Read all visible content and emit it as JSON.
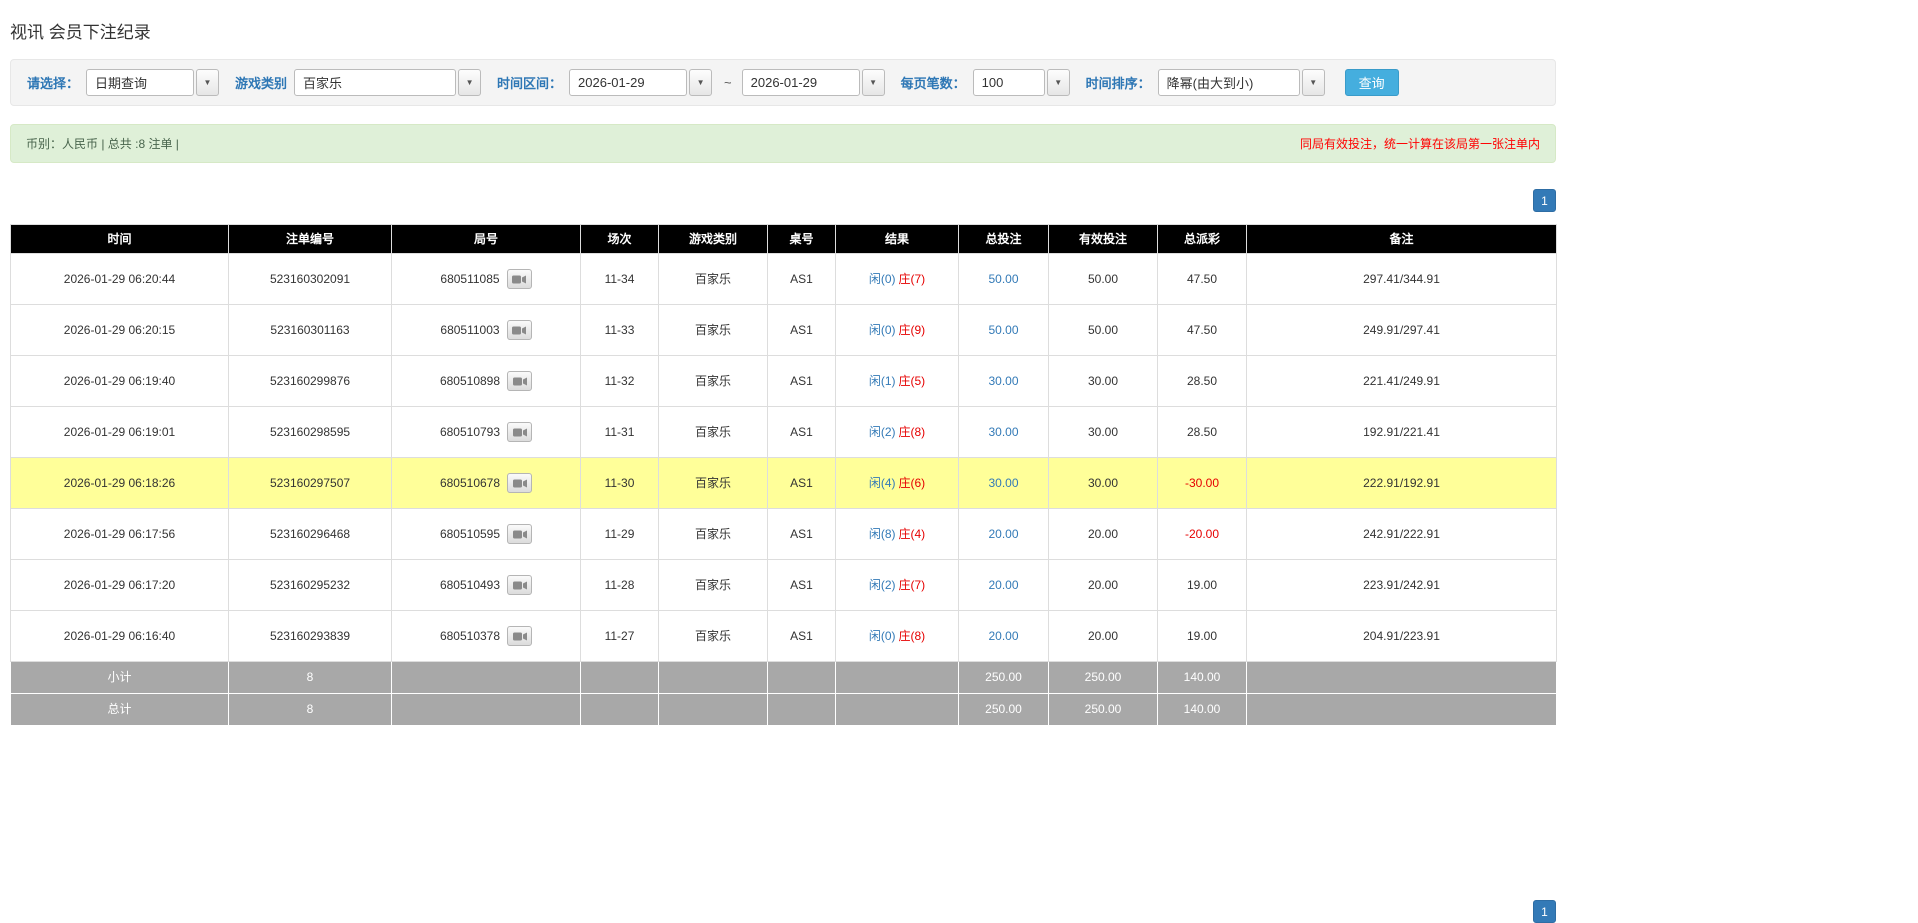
{
  "page": {
    "title": "视讯 会员下注纪录"
  },
  "filters": {
    "select": {
      "label": "请选择：",
      "value": "日期查询"
    },
    "game_type": {
      "label": "游戏类别",
      "value": "百家乐"
    },
    "time_range": {
      "label": "时间区间：",
      "from": "2026-01-29",
      "separator": "~",
      "to": "2026-01-29"
    },
    "page_size": {
      "label": "每页笔数：",
      "value": "100"
    },
    "sort": {
      "label": "时间排序：",
      "value": "降幂(由大到小)"
    },
    "search_button": "查询"
  },
  "summary": {
    "currency_info": "币别：人民币 | 总共 :8 注单 |",
    "notice": "同局有效投注，统一计算在该局第一张注单内"
  },
  "pagination": {
    "current_page": "1"
  },
  "icons": {
    "dropdown_caret": "▼",
    "video_replay": "video-replay-icon"
  },
  "colors": {
    "accent_blue": "#337ab7",
    "result_red": "#e60000",
    "highlight_yellow": "#ffff99",
    "header_black": "#000000",
    "footer_gray": "#a8a8a8",
    "search_button_blue": "#45aede",
    "summary_green_bg": "#dff0d8",
    "notice_red": "#ff0000"
  },
  "table": {
    "headers": [
      "时间",
      "注单编号",
      "局号",
      "场次",
      "游戏类别",
      "桌号",
      "结果",
      "总投注",
      "有效投注",
      "总派彩",
      "备注"
    ],
    "rows": [
      {
        "time": "2026-01-29 06:20:44",
        "bet_id": "523160302091",
        "round_id": "680511085",
        "session": "11-34",
        "game": "百家乐",
        "table_no": "AS1",
        "result_player": "闲(0)",
        "result_banker": "庄(7)",
        "total_bet": "50.00",
        "valid_bet": "50.00",
        "payout": "47.50",
        "remark": "297.41/344.91",
        "highlighted": false
      },
      {
        "time": "2026-01-29 06:20:15",
        "bet_id": "523160301163",
        "round_id": "680511003",
        "session": "11-33",
        "game": "百家乐",
        "table_no": "AS1",
        "result_player": "闲(0)",
        "result_banker": "庄(9)",
        "total_bet": "50.00",
        "valid_bet": "50.00",
        "payout": "47.50",
        "remark": "249.91/297.41",
        "highlighted": false
      },
      {
        "time": "2026-01-29 06:19:40",
        "bet_id": "523160299876",
        "round_id": "680510898",
        "session": "11-32",
        "game": "百家乐",
        "table_no": "AS1",
        "result_player": "闲(1)",
        "result_banker": "庄(5)",
        "total_bet": "30.00",
        "valid_bet": "30.00",
        "payout": "28.50",
        "remark": "221.41/249.91",
        "highlighted": false
      },
      {
        "time": "2026-01-29 06:19:01",
        "bet_id": "523160298595",
        "round_id": "680510793",
        "session": "11-31",
        "game": "百家乐",
        "table_no": "AS1",
        "result_player": "闲(2)",
        "result_banker": "庄(8)",
        "total_bet": "30.00",
        "valid_bet": "30.00",
        "payout": "28.50",
        "remark": "192.91/221.41",
        "highlighted": false
      },
      {
        "time": "2026-01-29 06:18:26",
        "bet_id": "523160297507",
        "round_id": "680510678",
        "session": "11-30",
        "game": "百家乐",
        "table_no": "AS1",
        "result_player": "闲(4)",
        "result_banker": "庄(6)",
        "total_bet": "30.00",
        "valid_bet": "30.00",
        "payout": "-30.00",
        "remark": "222.91/192.91",
        "highlighted": true
      },
      {
        "time": "2026-01-29 06:17:56",
        "bet_id": "523160296468",
        "round_id": "680510595",
        "session": "11-29",
        "game": "百家乐",
        "table_no": "AS1",
        "result_player": "闲(8)",
        "result_banker": "庄(4)",
        "total_bet": "20.00",
        "valid_bet": "20.00",
        "payout": "-20.00",
        "remark": "242.91/222.91",
        "highlighted": false
      },
      {
        "time": "2026-01-29 06:17:20",
        "bet_id": "523160295232",
        "round_id": "680510493",
        "session": "11-28",
        "game": "百家乐",
        "table_no": "AS1",
        "result_player": "闲(2)",
        "result_banker": "庄(7)",
        "total_bet": "20.00",
        "valid_bet": "20.00",
        "payout": "19.00",
        "remark": "223.91/242.91",
        "highlighted": false
      },
      {
        "time": "2026-01-29 06:16:40",
        "bet_id": "523160293839",
        "round_id": "680510378",
        "session": "11-27",
        "game": "百家乐",
        "table_no": "AS1",
        "result_player": "闲(0)",
        "result_banker": "庄(8)",
        "total_bet": "20.00",
        "valid_bet": "20.00",
        "payout": "19.00",
        "remark": "204.91/223.91",
        "highlighted": false
      }
    ],
    "footer_rows": [
      {
        "label": "小计",
        "count": "8",
        "total_bet": "250.00",
        "valid_bet": "250.00",
        "payout": "140.00",
        "remark": ""
      },
      {
        "label": "总计",
        "count": "8",
        "total_bet": "250.00",
        "valid_bet": "250.00",
        "payout": "140.00",
        "remark": ""
      }
    ]
  }
}
